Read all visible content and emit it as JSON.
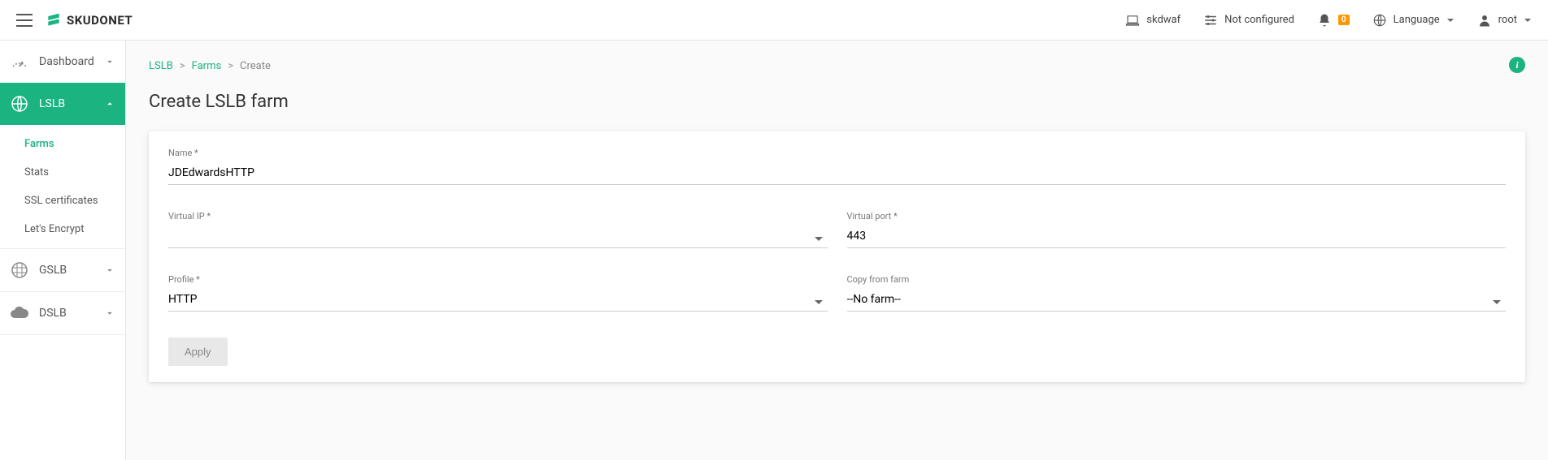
{
  "brand": "SKUDONET",
  "header": {
    "hostname": "skdwaf",
    "config_status": "Not configured",
    "notification_count": "0",
    "language_label": "Language",
    "user": "root"
  },
  "sidebar": {
    "items": [
      {
        "label": "Dashboard"
      },
      {
        "label": "LSLB"
      },
      {
        "label": "GSLB"
      },
      {
        "label": "DSLB"
      }
    ],
    "lslb_subitems": [
      {
        "label": "Farms"
      },
      {
        "label": "Stats"
      },
      {
        "label": "SSL certificates"
      },
      {
        "label": "Let's Encrypt"
      }
    ]
  },
  "breadcrumb": {
    "item1": "LSLB",
    "item2": "Farms",
    "current": "Create"
  },
  "page": {
    "title": "Create LSLB farm"
  },
  "form": {
    "name": {
      "label": "Name *",
      "value": "JDEdwardsHTTP"
    },
    "virtual_ip": {
      "label": "Virtual IP *",
      "value": ""
    },
    "virtual_port": {
      "label": "Virtual port *",
      "value": "443"
    },
    "profile": {
      "label": "Profile *",
      "value": "HTTP"
    },
    "copy_from": {
      "label": "Copy from farm",
      "value": "--No farm--"
    },
    "apply_label": "Apply"
  }
}
